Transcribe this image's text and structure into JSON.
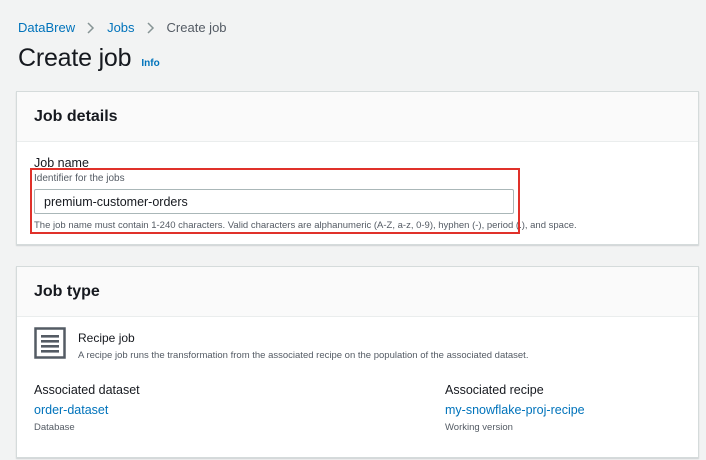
{
  "breadcrumb": {
    "items": [
      {
        "label": "DataBrew"
      },
      {
        "label": "Jobs"
      },
      {
        "label": "Create job"
      }
    ]
  },
  "header": {
    "title": "Create job",
    "info": "Info"
  },
  "job_details": {
    "title": "Job details",
    "job_name": {
      "label": "Job name",
      "description": "Identifier for the jobs",
      "value": "premium-customer-orders",
      "constraint": "The job name must contain 1-240 characters. Valid characters are alphanumeric (A-Z, a-z, 0-9), hyphen (-), period (.), and space."
    },
    "highlight_color": "#e0312a"
  },
  "job_type": {
    "title": "Job type",
    "option": {
      "icon": "recipe-job-icon",
      "label": "Recipe job",
      "description": "A recipe job runs the transformation from the associated recipe on the population of the associated dataset."
    },
    "associated_dataset": {
      "label": "Associated dataset",
      "value": "order-dataset",
      "sub": "Database"
    },
    "associated_recipe": {
      "label": "Associated recipe",
      "value": "my-snowflake-proj-recipe",
      "sub": "Working version"
    }
  },
  "colors": {
    "link": "#0073bb",
    "text": "#16191f",
    "muted": "#545b64",
    "background": "#f2f3f3"
  }
}
